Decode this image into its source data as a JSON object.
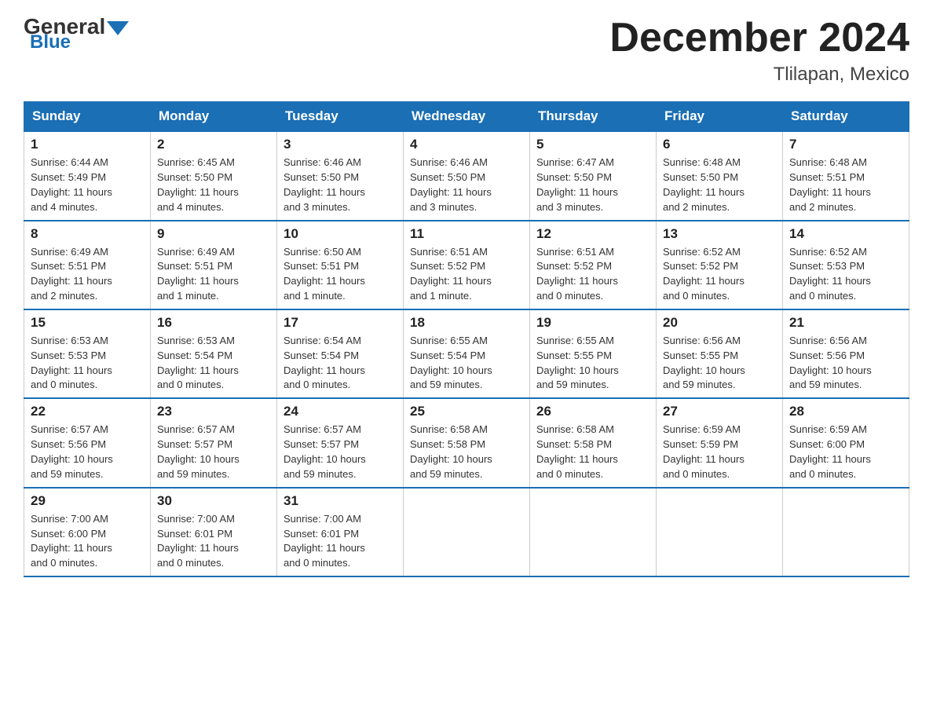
{
  "logo": {
    "general": "General",
    "blue": "Blue"
  },
  "title": "December 2024",
  "subtitle": "Tlilapan, Mexico",
  "days_of_week": [
    "Sunday",
    "Monday",
    "Tuesday",
    "Wednesday",
    "Thursday",
    "Friday",
    "Saturday"
  ],
  "weeks": [
    [
      {
        "num": "1",
        "info": "Sunrise: 6:44 AM\nSunset: 5:49 PM\nDaylight: 11 hours\nand 4 minutes."
      },
      {
        "num": "2",
        "info": "Sunrise: 6:45 AM\nSunset: 5:50 PM\nDaylight: 11 hours\nand 4 minutes."
      },
      {
        "num": "3",
        "info": "Sunrise: 6:46 AM\nSunset: 5:50 PM\nDaylight: 11 hours\nand 3 minutes."
      },
      {
        "num": "4",
        "info": "Sunrise: 6:46 AM\nSunset: 5:50 PM\nDaylight: 11 hours\nand 3 minutes."
      },
      {
        "num": "5",
        "info": "Sunrise: 6:47 AM\nSunset: 5:50 PM\nDaylight: 11 hours\nand 3 minutes."
      },
      {
        "num": "6",
        "info": "Sunrise: 6:48 AM\nSunset: 5:50 PM\nDaylight: 11 hours\nand 2 minutes."
      },
      {
        "num": "7",
        "info": "Sunrise: 6:48 AM\nSunset: 5:51 PM\nDaylight: 11 hours\nand 2 minutes."
      }
    ],
    [
      {
        "num": "8",
        "info": "Sunrise: 6:49 AM\nSunset: 5:51 PM\nDaylight: 11 hours\nand 2 minutes."
      },
      {
        "num": "9",
        "info": "Sunrise: 6:49 AM\nSunset: 5:51 PM\nDaylight: 11 hours\nand 1 minute."
      },
      {
        "num": "10",
        "info": "Sunrise: 6:50 AM\nSunset: 5:51 PM\nDaylight: 11 hours\nand 1 minute."
      },
      {
        "num": "11",
        "info": "Sunrise: 6:51 AM\nSunset: 5:52 PM\nDaylight: 11 hours\nand 1 minute."
      },
      {
        "num": "12",
        "info": "Sunrise: 6:51 AM\nSunset: 5:52 PM\nDaylight: 11 hours\nand 0 minutes."
      },
      {
        "num": "13",
        "info": "Sunrise: 6:52 AM\nSunset: 5:52 PM\nDaylight: 11 hours\nand 0 minutes."
      },
      {
        "num": "14",
        "info": "Sunrise: 6:52 AM\nSunset: 5:53 PM\nDaylight: 11 hours\nand 0 minutes."
      }
    ],
    [
      {
        "num": "15",
        "info": "Sunrise: 6:53 AM\nSunset: 5:53 PM\nDaylight: 11 hours\nand 0 minutes."
      },
      {
        "num": "16",
        "info": "Sunrise: 6:53 AM\nSunset: 5:54 PM\nDaylight: 11 hours\nand 0 minutes."
      },
      {
        "num": "17",
        "info": "Sunrise: 6:54 AM\nSunset: 5:54 PM\nDaylight: 11 hours\nand 0 minutes."
      },
      {
        "num": "18",
        "info": "Sunrise: 6:55 AM\nSunset: 5:54 PM\nDaylight: 10 hours\nand 59 minutes."
      },
      {
        "num": "19",
        "info": "Sunrise: 6:55 AM\nSunset: 5:55 PM\nDaylight: 10 hours\nand 59 minutes."
      },
      {
        "num": "20",
        "info": "Sunrise: 6:56 AM\nSunset: 5:55 PM\nDaylight: 10 hours\nand 59 minutes."
      },
      {
        "num": "21",
        "info": "Sunrise: 6:56 AM\nSunset: 5:56 PM\nDaylight: 10 hours\nand 59 minutes."
      }
    ],
    [
      {
        "num": "22",
        "info": "Sunrise: 6:57 AM\nSunset: 5:56 PM\nDaylight: 10 hours\nand 59 minutes."
      },
      {
        "num": "23",
        "info": "Sunrise: 6:57 AM\nSunset: 5:57 PM\nDaylight: 10 hours\nand 59 minutes."
      },
      {
        "num": "24",
        "info": "Sunrise: 6:57 AM\nSunset: 5:57 PM\nDaylight: 10 hours\nand 59 minutes."
      },
      {
        "num": "25",
        "info": "Sunrise: 6:58 AM\nSunset: 5:58 PM\nDaylight: 10 hours\nand 59 minutes."
      },
      {
        "num": "26",
        "info": "Sunrise: 6:58 AM\nSunset: 5:58 PM\nDaylight: 11 hours\nand 0 minutes."
      },
      {
        "num": "27",
        "info": "Sunrise: 6:59 AM\nSunset: 5:59 PM\nDaylight: 11 hours\nand 0 minutes."
      },
      {
        "num": "28",
        "info": "Sunrise: 6:59 AM\nSunset: 6:00 PM\nDaylight: 11 hours\nand 0 minutes."
      }
    ],
    [
      {
        "num": "29",
        "info": "Sunrise: 7:00 AM\nSunset: 6:00 PM\nDaylight: 11 hours\nand 0 minutes."
      },
      {
        "num": "30",
        "info": "Sunrise: 7:00 AM\nSunset: 6:01 PM\nDaylight: 11 hours\nand 0 minutes."
      },
      {
        "num": "31",
        "info": "Sunrise: 7:00 AM\nSunset: 6:01 PM\nDaylight: 11 hours\nand 0 minutes."
      },
      null,
      null,
      null,
      null
    ]
  ]
}
